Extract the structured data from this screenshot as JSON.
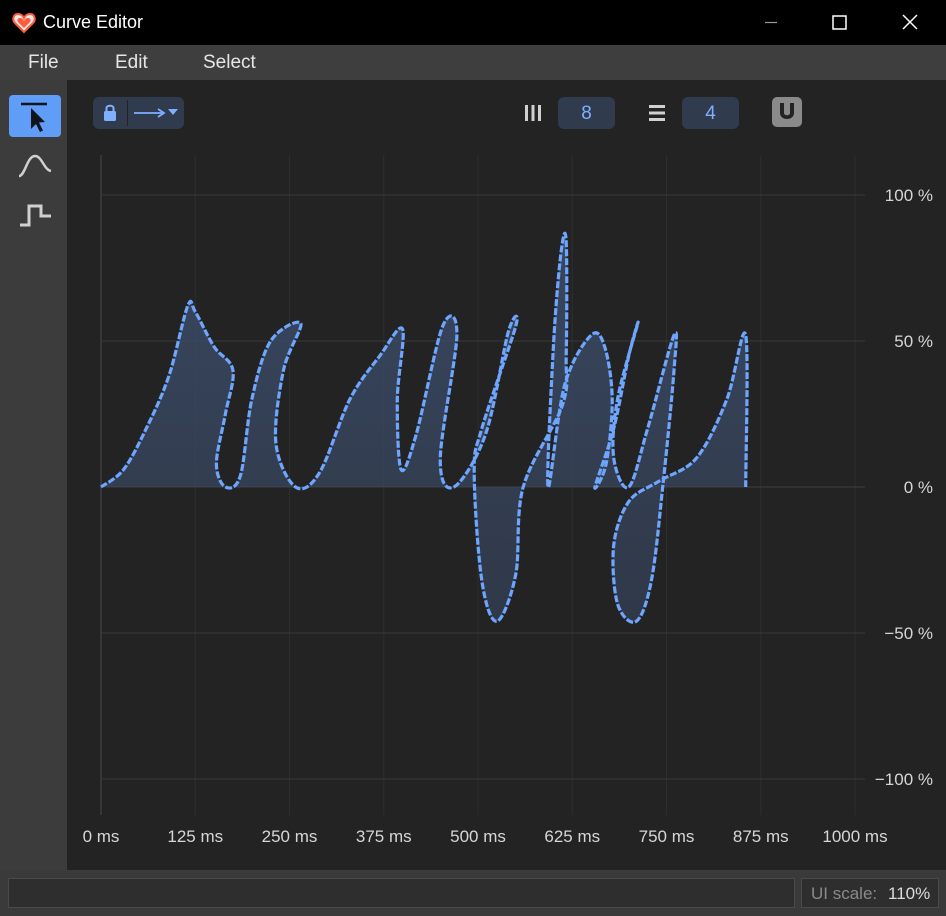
{
  "window": {
    "title": "Curve Editor",
    "buttons": [
      "minimize",
      "maximize",
      "close"
    ]
  },
  "menu": {
    "items": [
      "File",
      "Edit",
      "Select"
    ]
  },
  "tools": [
    {
      "name": "select-tool",
      "icon": "pointer-arrow-icon",
      "active": true
    },
    {
      "name": "smooth-curve-tool",
      "icon": "smooth-curve-icon",
      "active": false
    },
    {
      "name": "step-curve-tool",
      "icon": "step-curve-icon",
      "active": false
    }
  ],
  "toolbar": {
    "lock_icon": "lock-icon",
    "direction_icon": "arrow-right-dropdown-icon",
    "columns_icon": "vertical-bars-icon",
    "columns_value": "8",
    "rows_icon": "horizontal-bars-icon",
    "rows_value": "4",
    "snap_icon": "magnet-icon"
  },
  "status": {
    "text": "",
    "scale_label": "UI scale:",
    "scale_value": "110%"
  },
  "chart_data": {
    "type": "line",
    "x_ticks": [
      "0 ms",
      "125 ms",
      "250 ms",
      "375 ms",
      "500 ms",
      "625 ms",
      "750 ms",
      "875 ms",
      "1000 ms"
    ],
    "y_ticks": [
      "100 %",
      "50 %",
      "0 %",
      "−50 %",
      "−100 %"
    ],
    "xlim": [
      0,
      1000
    ],
    "ylim": [
      -100,
      100
    ],
    "grid": true,
    "colors": {
      "curve": "#6ea6ff",
      "fill": "#3a4a66",
      "grid": "#3a3a3a",
      "background": "#232323"
    },
    "points": [
      [
        0,
        0
      ],
      [
        30,
        6
      ],
      [
        60,
        20
      ],
      [
        90,
        38
      ],
      [
        115,
        62
      ],
      [
        125,
        60
      ],
      [
        150,
        48
      ],
      [
        175,
        40
      ],
      [
        165,
        25
      ],
      [
        153,
        8
      ],
      [
        165,
        0
      ],
      [
        185,
        4
      ],
      [
        200,
        30
      ],
      [
        225,
        50
      ],
      [
        265,
        56
      ],
      [
        242,
        40
      ],
      [
        232,
        15
      ],
      [
        258,
        0
      ],
      [
        290,
        5
      ],
      [
        330,
        30
      ],
      [
        370,
        45
      ],
      [
        400,
        54
      ],
      [
        393,
        30
      ],
      [
        398,
        6
      ],
      [
        418,
        18
      ],
      [
        453,
        55
      ],
      [
        472,
        52
      ],
      [
        450,
        10
      ],
      [
        468,
        0
      ],
      [
        510,
        18
      ],
      [
        540,
        53
      ],
      [
        550,
        55
      ],
      [
        505,
        20
      ],
      [
        495,
        5
      ],
      [
        505,
        -32
      ],
      [
        525,
        -46
      ],
      [
        550,
        -30
      ],
      [
        560,
        0
      ],
      [
        612,
        28
      ],
      [
        617,
        45
      ],
      [
        617,
        84
      ],
      [
        610,
        80
      ],
      [
        600,
        48
      ],
      [
        593,
        0
      ],
      [
        615,
        35
      ],
      [
        650,
        52
      ],
      [
        668,
        48
      ],
      [
        678,
        30
      ],
      [
        670,
        8
      ],
      [
        655,
        0
      ],
      [
        680,
        20
      ],
      [
        700,
        45
      ],
      [
        712,
        56
      ],
      [
        685,
        30
      ],
      [
        680,
        10
      ],
      [
        700,
        0
      ],
      [
        725,
        20
      ],
      [
        760,
        52
      ],
      [
        760,
        40
      ],
      [
        745,
        0
      ],
      [
        730,
        -32
      ],
      [
        710,
        -46
      ],
      [
        685,
        -40
      ],
      [
        680,
        -20
      ],
      [
        700,
        -5
      ],
      [
        740,
        2
      ],
      [
        790,
        10
      ],
      [
        830,
        30
      ],
      [
        855,
        52
      ],
      [
        855,
        0
      ]
    ]
  }
}
